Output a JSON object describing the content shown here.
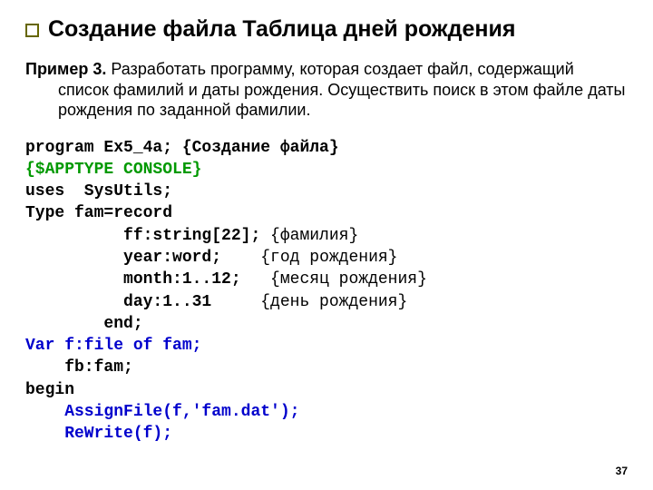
{
  "title": "Создание файла Таблица дней рождения",
  "body": {
    "label": "Пример 3.",
    "text": " Разработать программу, которая создает файл, содержащий список фамилий и даты рождения. Осуществить поиск в этом файле даты рождения по заданной фамилии."
  },
  "code": {
    "l1a": "program Ex5_4a; ",
    "l1b": "{Создание файла}",
    "l2": "{$APPTYPE CONSOLE}",
    "l3": "uses  SysUtils;",
    "l4": "Type fam=record",
    "l5a": "          ff:string[22];",
    "l5b": " {фамилия}",
    "l6a": "          year:word;",
    "l6b": "    {год рождения}",
    "l7a": "          month:1..12;",
    "l7b": "   {месяц рождения}",
    "l8a": "          day:1..31",
    "l8b": "     {день рождения}",
    "l9": "        end;",
    "l10": "Var f:file of fam;",
    "l11": "    fb:fam;",
    "l12": "begin",
    "l13": "    AssignFile(f,'fam.dat');",
    "l14": "    ReWrite(f);"
  },
  "pagenum": "37"
}
